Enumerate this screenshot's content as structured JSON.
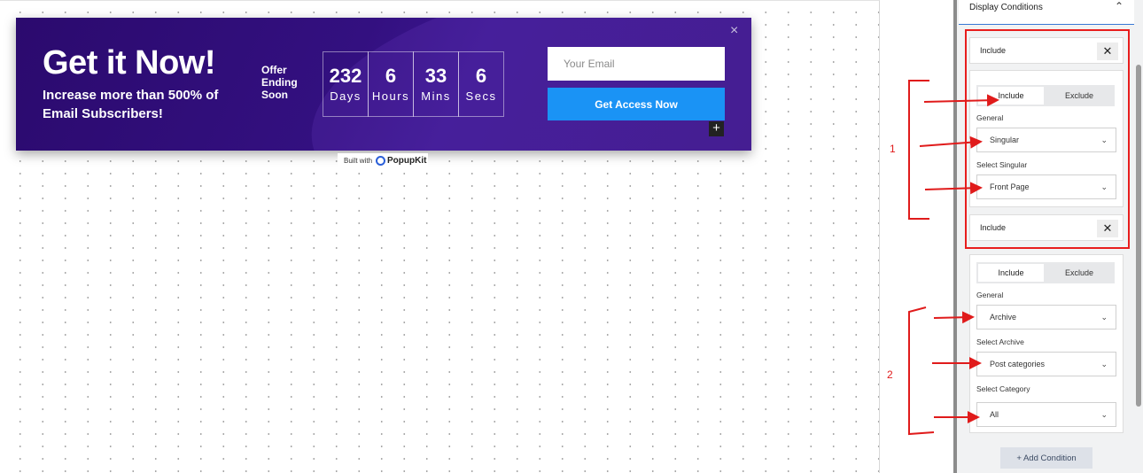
{
  "popup": {
    "headline": "Get it Now!",
    "subheadline": "Increase more than 500% of Email Subscribers!",
    "offer_label": "Offer Ending Soon",
    "countdown": [
      {
        "value": "232",
        "unit": "Days"
      },
      {
        "value": "6",
        "unit": "Hours"
      },
      {
        "value": "33",
        "unit": "Mins"
      },
      {
        "value": "6",
        "unit": "Secs"
      }
    ],
    "email_placeholder": "Your Email",
    "cta_label": "Get Access Now",
    "close_glyph": "×",
    "add_glyph": "+",
    "built_with": "Built with",
    "brand": "PopupKit"
  },
  "panel": {
    "title": "Display Conditions",
    "conditions": [
      {
        "header": "Include",
        "remove_glyph": "✕",
        "toggle": {
          "include": "Include",
          "exclude": "Exclude",
          "active": "Include"
        },
        "general_label": "General",
        "general_value": "Singular",
        "select_label": "Select Singular",
        "select_value": "Front Page"
      },
      {
        "header": "Include",
        "remove_glyph": "✕",
        "toggle": {
          "include": "Include",
          "exclude": "Exclude",
          "active": "Include"
        },
        "general_label": "General",
        "general_value": "Archive",
        "select_label": "Select Archive",
        "select_value": "Post categories",
        "category_label": "Select Category",
        "category_value": "All"
      }
    ],
    "add_condition": "+ Add Condition"
  },
  "annotations": {
    "label_1": "1",
    "label_2": "2",
    "color": "#e01b1b"
  },
  "colors": {
    "popup_bg": "#331080",
    "cta": "#1a93f5",
    "accent": "#3877d4"
  }
}
